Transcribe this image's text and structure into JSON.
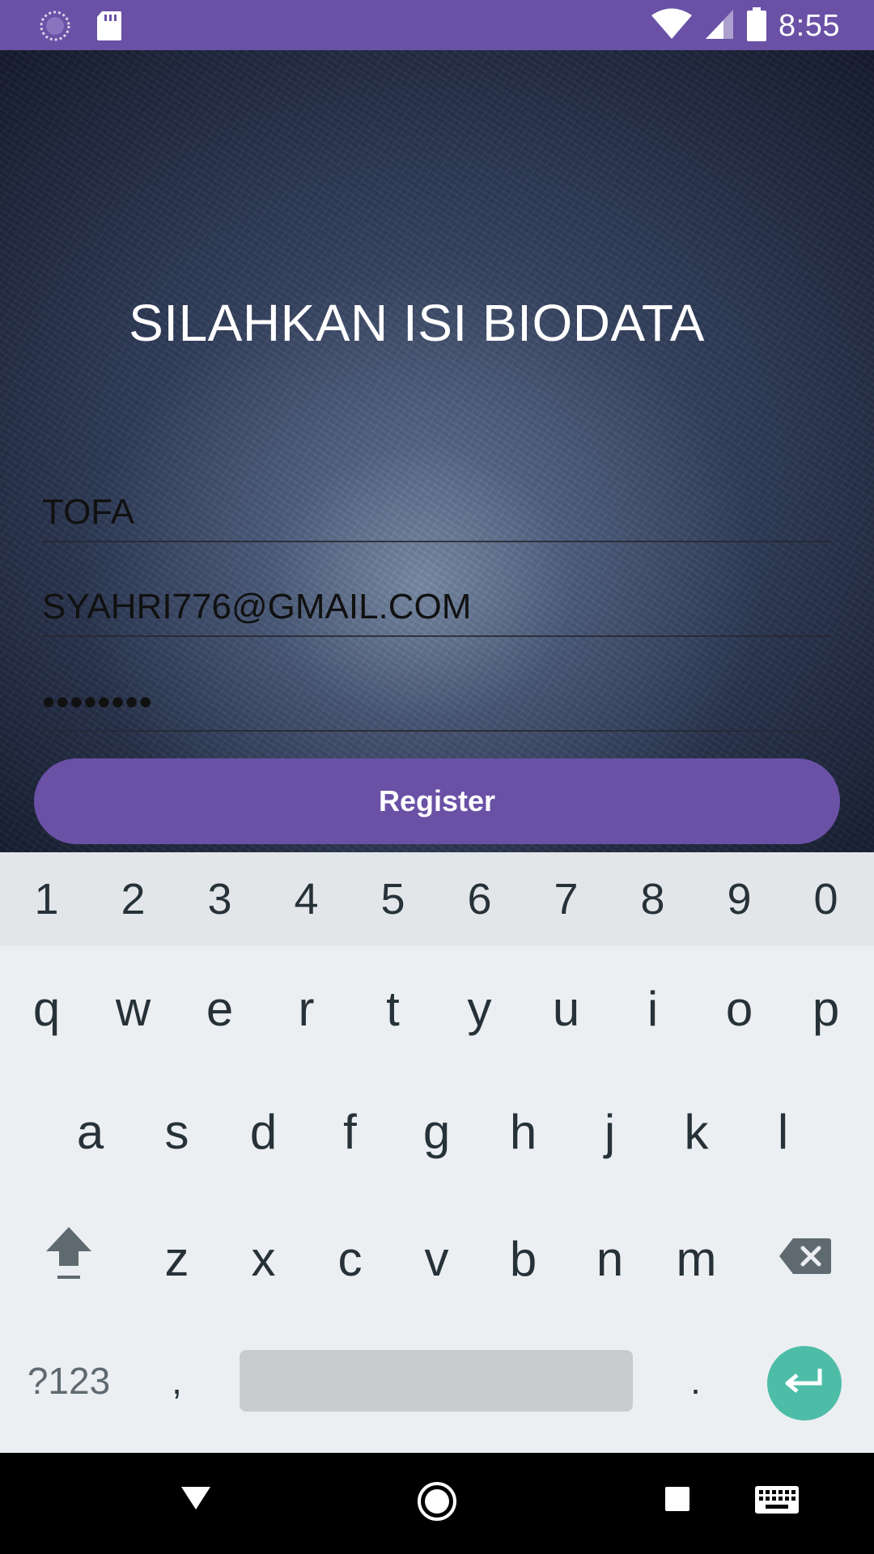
{
  "status_bar": {
    "time": "8:55",
    "left_icons": [
      "loading-icon",
      "sd-card-icon"
    ],
    "right_icons": [
      "wifi-icon",
      "cell-signal-icon",
      "battery-icon"
    ],
    "color": "#6a51a6"
  },
  "form": {
    "title": "SILAHKAN ISI BIODATA",
    "name_value": "TOFA",
    "email_value": "SYAHRI776@GMAIL.COM",
    "password_value": "••••••••",
    "register_label": "Register"
  },
  "keyboard": {
    "number_row": [
      "1",
      "2",
      "3",
      "4",
      "5",
      "6",
      "7",
      "8",
      "9",
      "0"
    ],
    "row1": [
      "q",
      "w",
      "e",
      "r",
      "t",
      "y",
      "u",
      "i",
      "o",
      "p"
    ],
    "row2": [
      "a",
      "s",
      "d",
      "f",
      "g",
      "h",
      "j",
      "k",
      "l"
    ],
    "row3": [
      "z",
      "x",
      "c",
      "v",
      "b",
      "n",
      "m"
    ],
    "symbols_label": "?123",
    "comma_label": ",",
    "period_label": ".",
    "enter_color": "#4dbda8"
  },
  "nav_bar": {
    "icons": [
      "back-icon",
      "home-icon",
      "recents-icon",
      "keyboard-icon"
    ]
  }
}
